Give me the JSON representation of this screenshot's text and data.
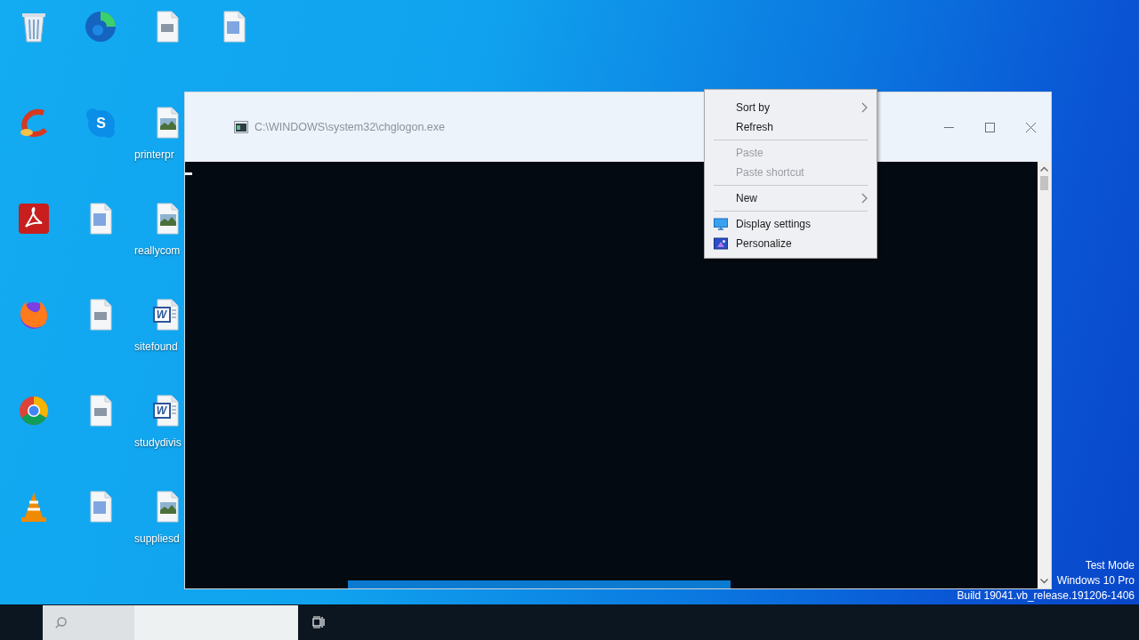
{
  "desktop": {
    "icons": [
      {
        "kind": "bin"
      },
      {
        "kind": "sweep"
      },
      {
        "kind": "pdf"
      },
      {
        "kind": "flame"
      },
      {
        "kind": "wheel"
      },
      {
        "kind": "cone"
      },
      {
        "kind": "swirl"
      },
      {
        "kind": "bubble",
        "glyph": "S"
      },
      {
        "kind": "bluedoc"
      },
      {
        "kind": "file"
      },
      {
        "kind": "file"
      },
      {
        "kind": "bluedoc"
      },
      {
        "kind": "file"
      },
      {
        "kind": "image",
        "label": "printerpr"
      },
      {
        "kind": "image",
        "label": "reallycom"
      },
      {
        "kind": "word",
        "glyph": "W",
        "label": "sitefound"
      },
      {
        "kind": "word",
        "glyph": "W",
        "label": "studydivis"
      },
      {
        "kind": "image",
        "label": "suppliesd"
      },
      {
        "kind": "bluedoc"
      }
    ]
  },
  "console_window": {
    "title": "C:\\WINDOWS\\system32\\chglogon.exe"
  },
  "context_menu": {
    "items": [
      {
        "kind": "submenu",
        "label": "Sort by",
        "disabled": false
      },
      {
        "kind": "command",
        "label": "Refresh",
        "disabled": false
      },
      {
        "kind": "separator"
      },
      {
        "kind": "command",
        "label": "Paste",
        "disabled": true
      },
      {
        "kind": "command",
        "label": "Paste shortcut",
        "disabled": true
      },
      {
        "kind": "separator"
      },
      {
        "kind": "submenu",
        "label": "New",
        "disabled": false
      },
      {
        "kind": "separator"
      },
      {
        "kind": "monitor",
        "label": "Display settings",
        "disabled": false
      },
      {
        "kind": "picture",
        "label": "Personalize",
        "disabled": false
      }
    ]
  },
  "system_watermark": {
    "lines": [
      "Test Mode",
      "Windows 10 Pro",
      "Build 19041.vb_release.191206-1406"
    ]
  }
}
